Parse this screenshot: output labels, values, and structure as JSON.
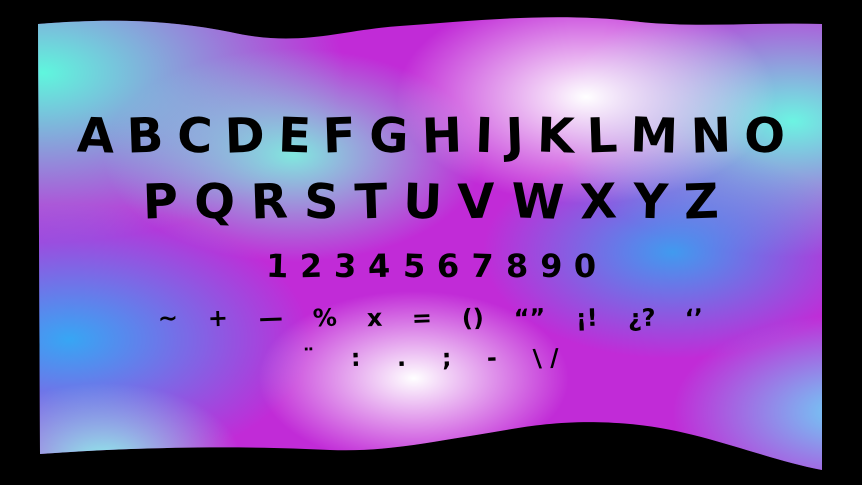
{
  "colors": {
    "background": "#000000",
    "text": "#000000",
    "gradient_cyan": "#4ff0d6",
    "gradient_magenta": "#c22ad6",
    "gradient_blue": "#3aa8f2",
    "gradient_white": "#fbf4ff"
  },
  "specimen": {
    "uppercase_row_1": [
      "A",
      "B",
      "C",
      "D",
      "E",
      "F",
      "G",
      "H",
      "I",
      "J",
      "K",
      "L",
      "M",
      "N",
      "O"
    ],
    "uppercase_row_2": [
      "P",
      "Q",
      "R",
      "S",
      "T",
      "U",
      "V",
      "W",
      "X",
      "Y",
      "Z"
    ],
    "digits": [
      "1",
      "2",
      "3",
      "4",
      "5",
      "6",
      "7",
      "8",
      "9",
      "0"
    ],
    "punctuation_row_1": [
      "~",
      "+",
      "—",
      "%",
      "x",
      "=",
      "()",
      "“”",
      "¡!",
      "¿?",
      "‘’"
    ],
    "punctuation_row_2": [
      "¨",
      ":",
      ".",
      ";",
      "-",
      "\\ /"
    ]
  }
}
